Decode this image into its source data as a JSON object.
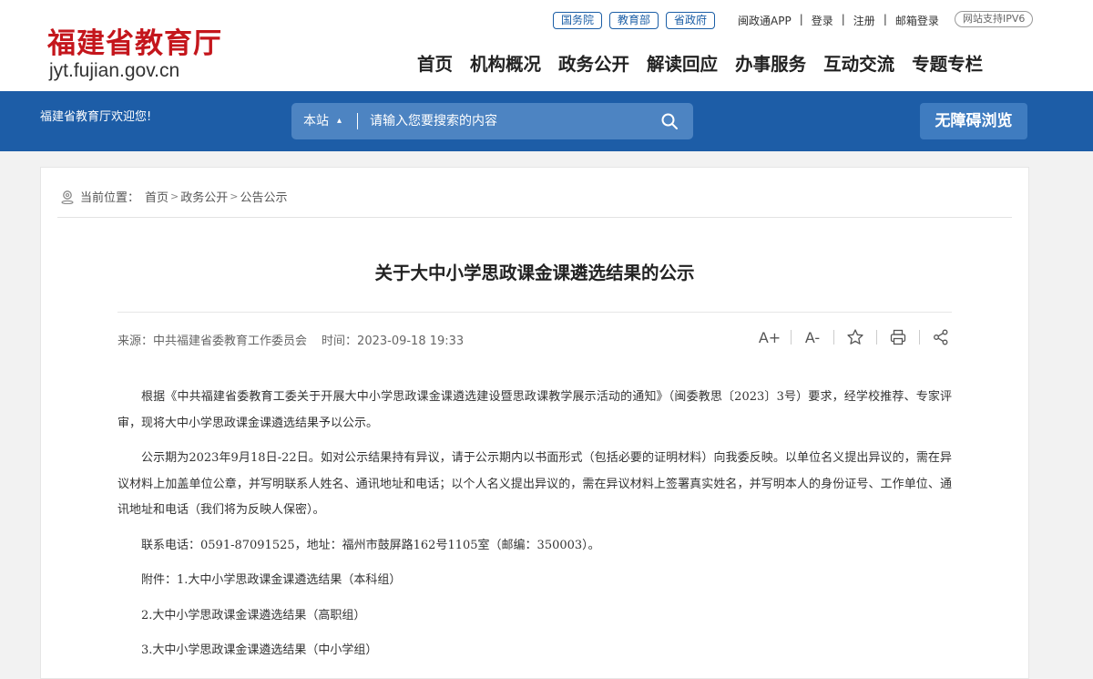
{
  "site": {
    "title_cn": "福建省教育厅",
    "url": "jyt.fujian.gov.cn"
  },
  "top_bar": {
    "gov_links": [
      "国务院",
      "教育部",
      "省政府"
    ],
    "links": [
      "闽政通APP",
      "登录",
      "注册",
      "邮箱登录"
    ],
    "ipv6": "网站支持IPV6"
  },
  "main_nav": [
    "首页",
    "机构概况",
    "政务公开",
    "解读回应",
    "办事服务",
    "互动交流",
    "专题专栏"
  ],
  "blue_bar": {
    "welcome": "福建省教育厅欢迎您!",
    "search_scope": "本站",
    "search_placeholder": "请输入您要搜索的内容",
    "accessible_label": "无障碍浏览"
  },
  "breadcrumb": {
    "prefix": "当前位置：",
    "items": [
      "首页",
      "政务公开",
      "公告公示"
    ]
  },
  "article": {
    "title": "关于大中小学思政课金课遴选结果的公示",
    "source_label": "来源：",
    "source": "中共福建省委教育工作委员会",
    "time_label": "时间：",
    "time": "2023-09-18 19:33",
    "tools": [
      "A+",
      "A-",
      "star-icon",
      "print-icon",
      "share-icon"
    ],
    "paragraphs": [
      "根据《中共福建省委教育工委关于开展大中小学思政课金课遴选建设暨思政课教学展示活动的通知》（闽委教思〔2023〕3号）要求，经学校推荐、专家评审，现将大中小学思政课金课遴选结果予以公示。",
      "公示期为2023年9月18日-22日。如对公示结果持有异议，请于公示期内以书面形式（包括必要的证明材料）向我委反映。以单位名义提出异议的，需在异议材料上加盖单位公章，并写明联系人姓名、通讯地址和电话；以个人名义提出异议的，需在异议材料上签署真实姓名，并写明本人的身份证号、工作单位、通讯地址和电话（我们将为反映人保密）。",
      "联系电话：0591-87091525，地址：福州市鼓屏路162号1105室（邮编：350003）。"
    ],
    "attachments": [
      "附件：1.大中小学思政课金课遴选结果（本科组）",
      "2.大中小学思政课金课遴选结果（高职组）",
      "3.大中小学思政课金课遴选结果（中小学组）"
    ]
  },
  "colors": {
    "brand_red": "#c4161c",
    "nav_blue": "#1d5da7",
    "search_bg": "#4d84c2"
  }
}
